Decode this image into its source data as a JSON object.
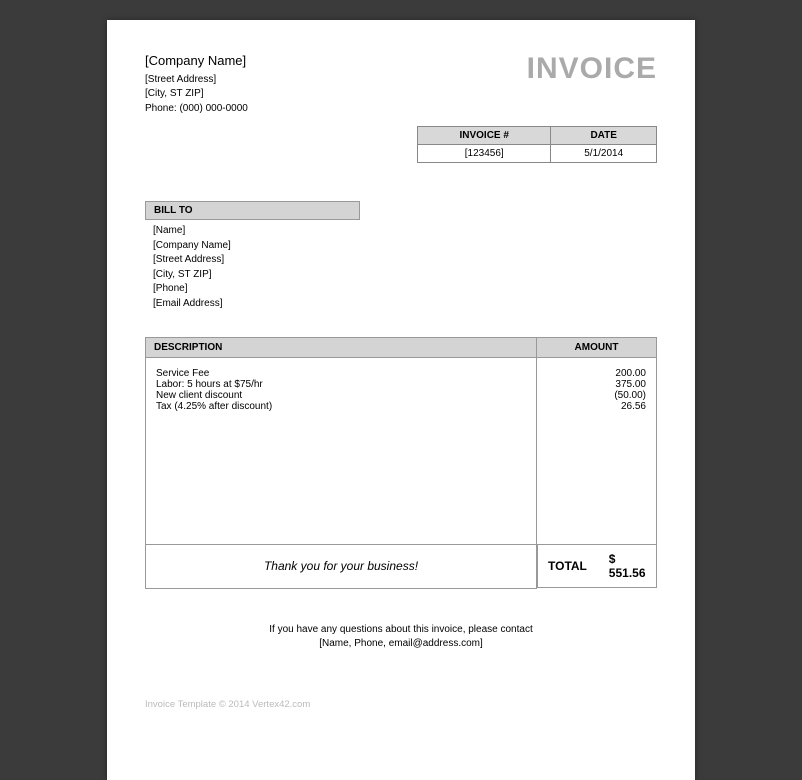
{
  "header": {
    "company_name": "[Company Name]",
    "street": "[Street Address]",
    "city_st_zip": "[City, ST ZIP]",
    "phone": "Phone: (000) 000-0000",
    "title": "INVOICE"
  },
  "meta": {
    "invoice_no_label": "INVOICE #",
    "date_label": "DATE",
    "invoice_no": "[123456]",
    "date": "5/1/2014"
  },
  "billto": {
    "header": "BILL TO",
    "name": "[Name]",
    "company": "[Company Name]",
    "street": "[Street Address]",
    "city_st_zip": "[City, ST  ZIP]",
    "phone": "[Phone]",
    "email": "[Email Address]"
  },
  "items": {
    "description_label": "DESCRIPTION",
    "amount_label": "AMOUNT",
    "rows": [
      {
        "desc": "Service Fee",
        "amount": "200.00"
      },
      {
        "desc": "Labor: 5 hours at $75/hr",
        "amount": "375.00"
      },
      {
        "desc": "New client discount",
        "amount": "(50.00)"
      },
      {
        "desc": "Tax (4.25% after discount)",
        "amount": "26.56"
      }
    ]
  },
  "totals": {
    "thank_you": "Thank you for your business!",
    "total_label": "TOTAL",
    "currency": "$",
    "total_amount": "551.56"
  },
  "footer": {
    "line1": "If you have any questions about this invoice, please contact",
    "line2": "[Name, Phone, email@address.com]",
    "copyright": "Invoice Template © 2014 Vertex42.com"
  }
}
